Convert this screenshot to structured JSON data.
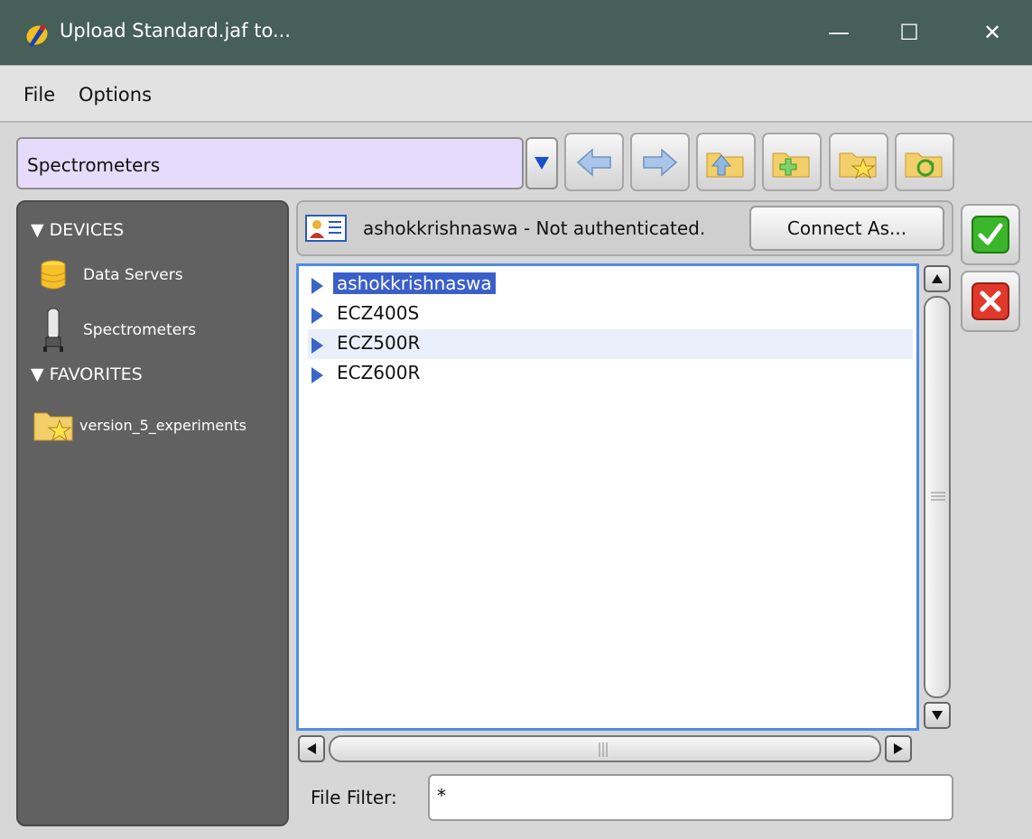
{
  "window": {
    "title": "Upload Standard.jaf to...",
    "controls": {
      "minimize": "—",
      "maximize": "☐",
      "close": "✕"
    }
  },
  "menu": {
    "items": [
      "File",
      "Options"
    ]
  },
  "toolbar": {
    "location_value": "Spectrometers",
    "buttons": [
      "back-icon",
      "forward-icon",
      "folder-up-icon",
      "new-folder-icon",
      "favorite-folder-icon",
      "refresh-folder-icon"
    ]
  },
  "sidebar": {
    "sections": [
      {
        "label": "DEVICES",
        "items": [
          {
            "label": "Data Servers",
            "icon": "database-icon"
          },
          {
            "label": "Spectrometers",
            "icon": "spectrometer-icon"
          }
        ]
      },
      {
        "label": "FAVORITES",
        "items": [
          {
            "label": "version_5_experiments",
            "icon": "favorite-folder-icon"
          }
        ]
      }
    ]
  },
  "auth": {
    "text": "ashokkrishnaswa - Not authenticated.",
    "connect_label": "Connect As..."
  },
  "list": {
    "items": [
      {
        "label": "ashokkrishnaswa",
        "selected": true
      },
      {
        "label": "ECZ400S",
        "selected": false
      },
      {
        "label": "ECZ500R",
        "selected": false
      },
      {
        "label": "ECZ600R",
        "selected": false
      }
    ]
  },
  "filter": {
    "label": "File Filter:",
    "value": "*"
  },
  "colors": {
    "titlebar": "#465f58",
    "selection": "#3b5fc9",
    "list_border": "#4f8ce4",
    "combo": "#e7dbfb"
  }
}
